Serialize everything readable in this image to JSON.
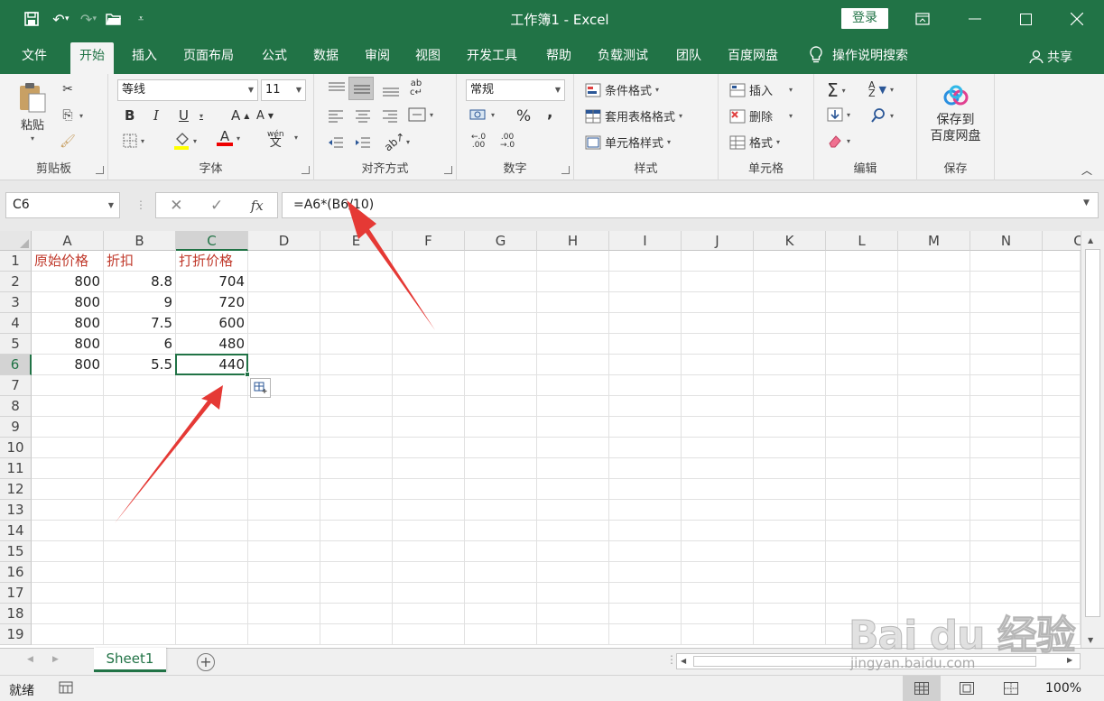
{
  "title_bar": {
    "document_title": "工作簿1  -  Excel",
    "login_label": "登录"
  },
  "tabs": [
    "文件",
    "开始",
    "插入",
    "页面布局",
    "公式",
    "数据",
    "审阅",
    "视图",
    "开发工具",
    "帮助",
    "负载测试",
    "团队",
    "百度网盘"
  ],
  "active_tab": "开始",
  "tell_me": "操作说明搜索",
  "share": "共享",
  "ribbon": {
    "clipboard": {
      "label": "剪贴板",
      "paste": "粘贴"
    },
    "font": {
      "label": "字体",
      "name": "等线",
      "size": "11",
      "bold": "B",
      "italic": "I",
      "underline": "U",
      "grow": "A",
      "shrink": "A",
      "font_color_glyph": "A",
      "phonetic": "wén"
    },
    "alignment": {
      "label": "对齐方式"
    },
    "number": {
      "label": "数字",
      "format": "常规",
      "percent": "%",
      "comma": ","
    },
    "styles": {
      "label": "样式",
      "conditional": "条件格式",
      "table": "套用表格格式",
      "cell_styles": "单元格样式"
    },
    "cells": {
      "label": "单元格",
      "insert": "插入",
      "delete": "删除",
      "format": "格式"
    },
    "editing": {
      "label": "编辑"
    },
    "save": {
      "label": "保存",
      "button": "保存到\n百度网盘"
    }
  },
  "formula_bar": {
    "name_box": "C6",
    "formula": "=A6*(B6/10)",
    "fx": "fx"
  },
  "columns": [
    "A",
    "B",
    "C",
    "D",
    "E",
    "F",
    "G",
    "H",
    "I",
    "J",
    "K",
    "L",
    "M",
    "N",
    "C"
  ],
  "rows": [
    "1",
    "2",
    "3",
    "4",
    "5",
    "6",
    "7",
    "8",
    "9",
    "10",
    "11",
    "12",
    "13",
    "14",
    "15",
    "16",
    "17",
    "18",
    "19"
  ],
  "cells": [
    [
      "原始价格",
      "折扣",
      "打折价格"
    ],
    [
      "800",
      "8.8",
      "704"
    ],
    [
      "800",
      "9",
      "720"
    ],
    [
      "800",
      "7.5",
      "600"
    ],
    [
      "800",
      "6",
      "480"
    ],
    [
      "800",
      "5.5",
      "440"
    ]
  ],
  "selected_cell": {
    "col": "C",
    "row": "6"
  },
  "sheet_tab": "Sheet1",
  "add_sheet": "+",
  "status": {
    "ready": "就绪",
    "zoom": "100%"
  },
  "watermark": {
    "logo": "Bai du 经验",
    "url": "jingyan.baidu.com"
  },
  "colors": {
    "excel_green": "#217346",
    "header_text": "#c0392b",
    "arrow": "#e53935"
  }
}
